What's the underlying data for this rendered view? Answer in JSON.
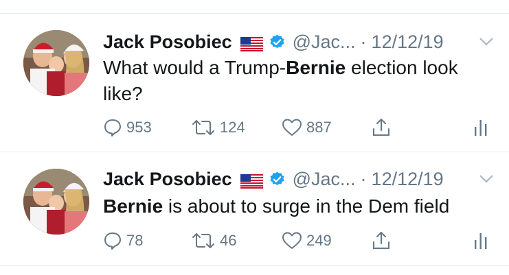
{
  "tweets": [
    {
      "author": "Jack Posobiec",
      "flag": "flag-us-icon",
      "verified": "verified-badge-icon",
      "handle": "@Jac...",
      "separator": "·",
      "date": "12/12/19",
      "text_parts": [
        "What would a Trump-",
        "Bernie",
        " election look like?"
      ],
      "replies": "953",
      "retweets": "124",
      "likes": "887"
    },
    {
      "author": "Jack Posobiec",
      "flag": "flag-us-icon",
      "verified": "verified-badge-icon",
      "handle": "@Jac...",
      "separator": "·",
      "date": "12/12/19",
      "text_parts": [
        "Bernie",
        " is about to surge in the Dem field"
      ],
      "replies": "78",
      "retweets": "46",
      "likes": "249"
    }
  ],
  "colors": {
    "text": "#14171a",
    "muted": "#657786",
    "verified": "#1da1f2",
    "divider": "#e6ecf0"
  }
}
